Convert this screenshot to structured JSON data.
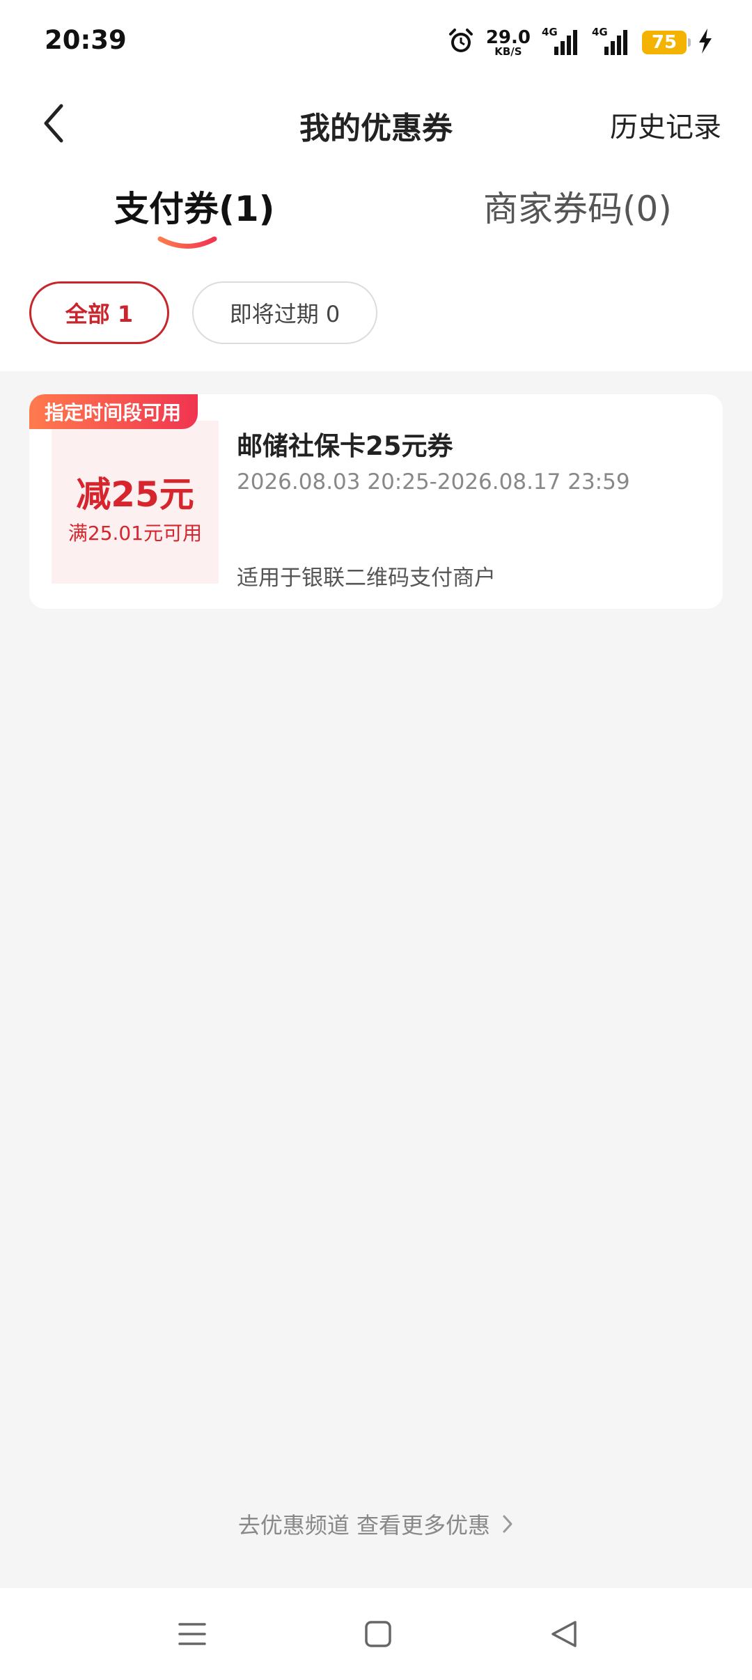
{
  "status_bar": {
    "time": "20:39",
    "net_speed_value": "29.0",
    "net_speed_unit": "KB/S",
    "signal_1_label": "4G",
    "signal_2_label": "4G",
    "battery_level": "75",
    "icons": [
      "alarm-icon",
      "signal-icon",
      "battery-icon",
      "charging-icon"
    ]
  },
  "header": {
    "title": "我的优惠券",
    "history_label": "历史记录"
  },
  "tabs": [
    {
      "label": "支付券(1)",
      "active": true
    },
    {
      "label": "商家券码(0)",
      "active": false
    }
  ],
  "filters": [
    {
      "label": "全部 1",
      "selected": true
    },
    {
      "label": "即将过期 0",
      "selected": false
    }
  ],
  "coupon": {
    "tag": "指定时间段可用",
    "amount": "减25元",
    "condition": "满25.01元可用",
    "name": "邮储社保卡25元券",
    "valid_period": "2026.08.03 20:25-2026.08.17 23:59",
    "scope": "适用于银联二维码支付商户"
  },
  "footer": {
    "more_link": "去优惠频道 查看更多优惠"
  },
  "colors": {
    "accent_red": "#d7252d",
    "chip_border_red": "#c8252c",
    "tag_gradient_start": "#ff7a4d",
    "tag_gradient_end": "#f03450",
    "battery": "#f5b301",
    "page_background": "#f5f5f5"
  }
}
